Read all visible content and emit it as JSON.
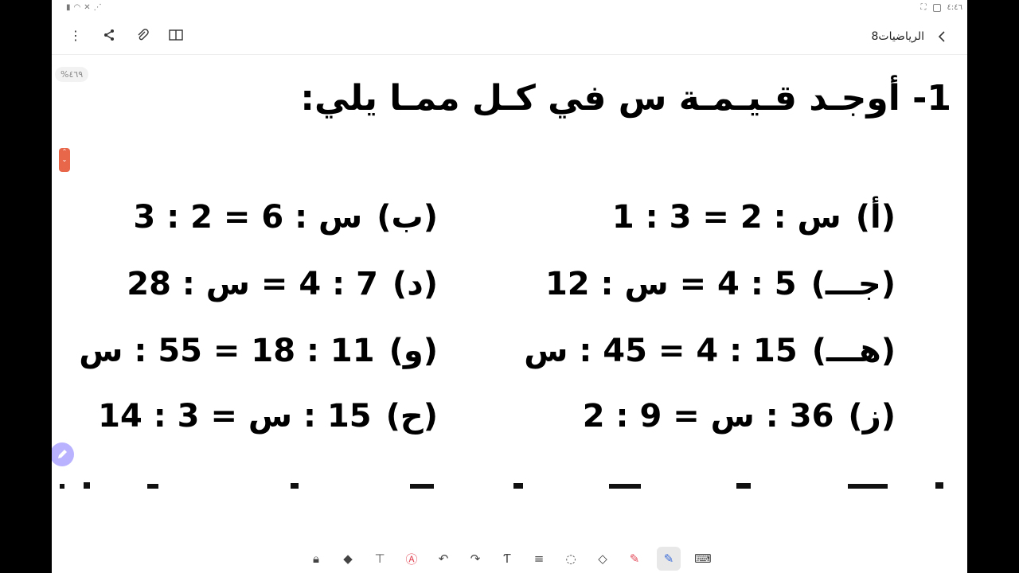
{
  "status": {
    "time": "٤:٤٦"
  },
  "app": {
    "title": "الرياضيات8",
    "zoom": "%٤٦٩"
  },
  "icons": {
    "back": "chevron-left-icon",
    "menu": "more-vert-icon",
    "share": "share-icon",
    "attach": "paperclip-icon",
    "book": "book-icon"
  },
  "question": {
    "title": "1-  أوجـد قـيـمـة س في كـل ممـا يلي:",
    "items": [
      {
        "label": "(أ)",
        "expr": "س  :  2  =  3  :  1"
      },
      {
        "label": "(ب)",
        "expr": "س  :  6  =  2  :  3"
      },
      {
        "label": "(جـــ)",
        "expr": "5  :  4  =  س  :  12"
      },
      {
        "label": "(د)",
        "expr": "7  :  4  =  س  :  28"
      },
      {
        "label": "(هـــ)",
        "expr": "15  :  4  =  45  :  س"
      },
      {
        "label": "(و)",
        "expr": "11  :  18  =  55  :  س"
      },
      {
        "label": "(ز)",
        "expr": "36  :  س  =  9  :  2"
      },
      {
        "label": "(ح)",
        "expr": "15  :  س  =  3  :  14"
      }
    ]
  },
  "toolbar": [
    "lock-icon",
    "shapes-icon",
    "text-box-icon",
    "handwriting-icon",
    "undo-icon",
    "redo-icon",
    "text-icon",
    "align-icon",
    "lasso-icon",
    "eraser-icon",
    "highlighter-icon",
    "pen-icon",
    "keyboard-icon"
  ]
}
